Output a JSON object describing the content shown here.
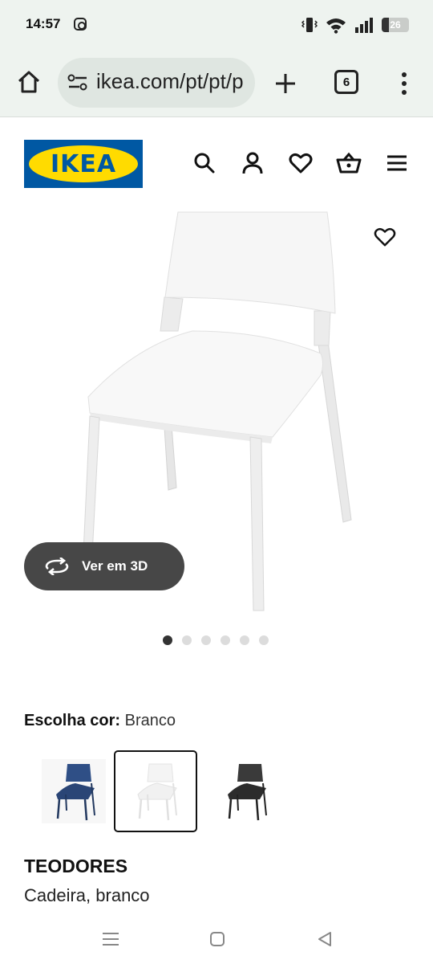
{
  "status_bar": {
    "time": "14:57",
    "battery_level": "26",
    "battery_fraction": 0.26,
    "icons": [
      "instagram-icon",
      "vibrate-icon",
      "wifi-icon",
      "signal-icon",
      "battery-icon"
    ]
  },
  "browser": {
    "url": "ikea.com/pt/pt/p",
    "tab_count": "6",
    "icons": [
      "home-icon",
      "site-settings-icon",
      "plus-icon",
      "more-icon"
    ]
  },
  "header": {
    "logo_text": "IKEA",
    "brand_colors": {
      "blue": "#0058a3",
      "yellow": "#ffdb00"
    },
    "icons": [
      "search-icon",
      "user-icon",
      "heart-icon",
      "basket-icon",
      "menu-icon"
    ]
  },
  "gallery": {
    "view_3d_label": "Ver em 3D",
    "image_count": 6,
    "active_index": 0,
    "favorite_icon": "heart-icon"
  },
  "color_chooser": {
    "label": "Escolha cor:",
    "selected_value": "Branco",
    "options": [
      {
        "color": "#2f4f86",
        "selected": false
      },
      {
        "color": "#ffffff",
        "selected": true
      },
      {
        "color": "#2f2f2f",
        "selected": false
      }
    ]
  },
  "product": {
    "name": "TEODORES",
    "description": "Cadeira, branco"
  },
  "nav_bar": {
    "icons": [
      "recents-icon",
      "home-square-icon",
      "back-icon"
    ]
  }
}
